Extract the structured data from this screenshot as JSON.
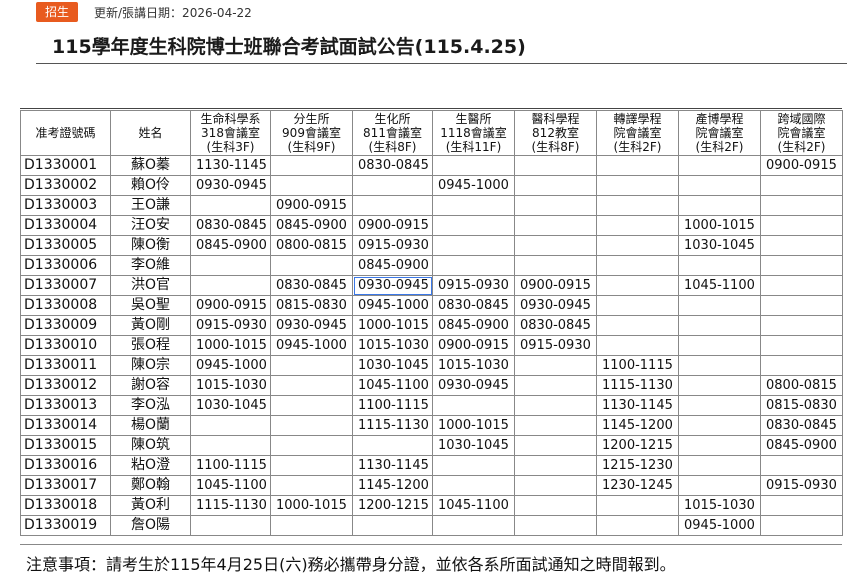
{
  "header": {
    "tag": "招生",
    "update_label": "更新/張講日期：2026-04-22",
    "title": "115學年度生科院博士班聯合考試面試公告(115.4.25)"
  },
  "table": {
    "columns": [
      [
        "准考證號碼"
      ],
      [
        "姓名"
      ],
      [
        "生命科學系",
        "318會議室",
        "(生科3F)"
      ],
      [
        "分生所",
        "909會議室",
        "(生科9F)"
      ],
      [
        "生化所",
        "811會議室",
        "(生科8F)"
      ],
      [
        "生醫所",
        "1118會議室",
        "(生科11F)"
      ],
      [
        "醫科學程",
        "812教室",
        "(生科8F)"
      ],
      [
        "轉譯學程",
        "院會議室",
        "(生科2F)"
      ],
      [
        "產博學程",
        "院會議室",
        "(生科2F)"
      ],
      [
        "跨域國際",
        "院會議室",
        "(生科2F)"
      ]
    ],
    "rows": [
      [
        "D1330001",
        "蘇O蓁",
        "1130-1145",
        "",
        "0830-0845",
        "",
        "",
        "",
        "",
        "0900-0915"
      ],
      [
        "D1330002",
        "賴O伶",
        "0930-0945",
        "",
        "",
        "0945-1000",
        "",
        "",
        "",
        ""
      ],
      [
        "D1330003",
        "王O謙",
        "",
        "0900-0915",
        "",
        "",
        "",
        "",
        "",
        ""
      ],
      [
        "D1330004",
        "汪O安",
        "0830-0845",
        "0845-0900",
        "0900-0915",
        "",
        "",
        "",
        "1000-1015",
        ""
      ],
      [
        "D1330005",
        "陳O衡",
        "0845-0900",
        "0800-0815",
        "0915-0930",
        "",
        "",
        "",
        "1030-1045",
        ""
      ],
      [
        "D1330006",
        "李O維",
        "",
        "",
        "0845-0900",
        "",
        "",
        "",
        "",
        ""
      ],
      [
        "D1330007",
        "洪O官",
        "",
        "0830-0845",
        "0930-0945",
        "0915-0930",
        "0900-0915",
        "",
        "1045-1100",
        ""
      ],
      [
        "D1330008",
        "吳O聖",
        "0900-0915",
        "0815-0830",
        "0945-1000",
        "0830-0845",
        "0930-0945",
        "",
        "",
        ""
      ],
      [
        "D1330009",
        "黃O剛",
        "0915-0930",
        "0930-0945",
        "1000-1015",
        "0845-0900",
        "0830-0845",
        "",
        "",
        ""
      ],
      [
        "D1330010",
        "張O程",
        "1000-1015",
        "0945-1000",
        "1015-1030",
        "0900-0915",
        "0915-0930",
        "",
        "",
        ""
      ],
      [
        "D1330011",
        "陳O宗",
        "0945-1000",
        "",
        "1030-1045",
        "1015-1030",
        "",
        "1100-1115",
        "",
        ""
      ],
      [
        "D1330012",
        "謝O容",
        "1015-1030",
        "",
        "1045-1100",
        "0930-0945",
        "",
        "1115-1130",
        "",
        "0800-0815"
      ],
      [
        "D1330013",
        "李O泓",
        "1030-1045",
        "",
        "1100-1115",
        "",
        "",
        "1130-1145",
        "",
        "0815-0830"
      ],
      [
        "D1330014",
        "楊O蘭",
        "",
        "",
        "1115-1130",
        "1000-1015",
        "",
        "1145-1200",
        "",
        "0830-0845"
      ],
      [
        "D1330015",
        "陳O筑",
        "",
        "",
        "",
        "1030-1045",
        "",
        "1200-1215",
        "",
        "0845-0900"
      ],
      [
        "D1330016",
        "粘O澄",
        "1100-1115",
        "",
        "1130-1145",
        "",
        "",
        "1215-1230",
        "",
        ""
      ],
      [
        "D1330017",
        "鄭O翰",
        "1045-1100",
        "",
        "1145-1200",
        "",
        "",
        "1230-1245",
        "",
        "0915-0930"
      ],
      [
        "D1330018",
        "黃O利",
        "1115-1130",
        "1000-1015",
        "1200-1215",
        "1045-1100",
        "",
        "",
        "1015-1030",
        ""
      ],
      [
        "D1330019",
        "詹O陽",
        "",
        "",
        "",
        "",
        "",
        "",
        "0945-1000",
        ""
      ]
    ]
  },
  "note": "注意事項：請考生於115年4月25日(六)務必攜帶身分證，並依各系所面試通知之時間報到。",
  "colors": {
    "tag_background": "#e85b1f",
    "selected_cell_outline": "#3b78e7"
  }
}
